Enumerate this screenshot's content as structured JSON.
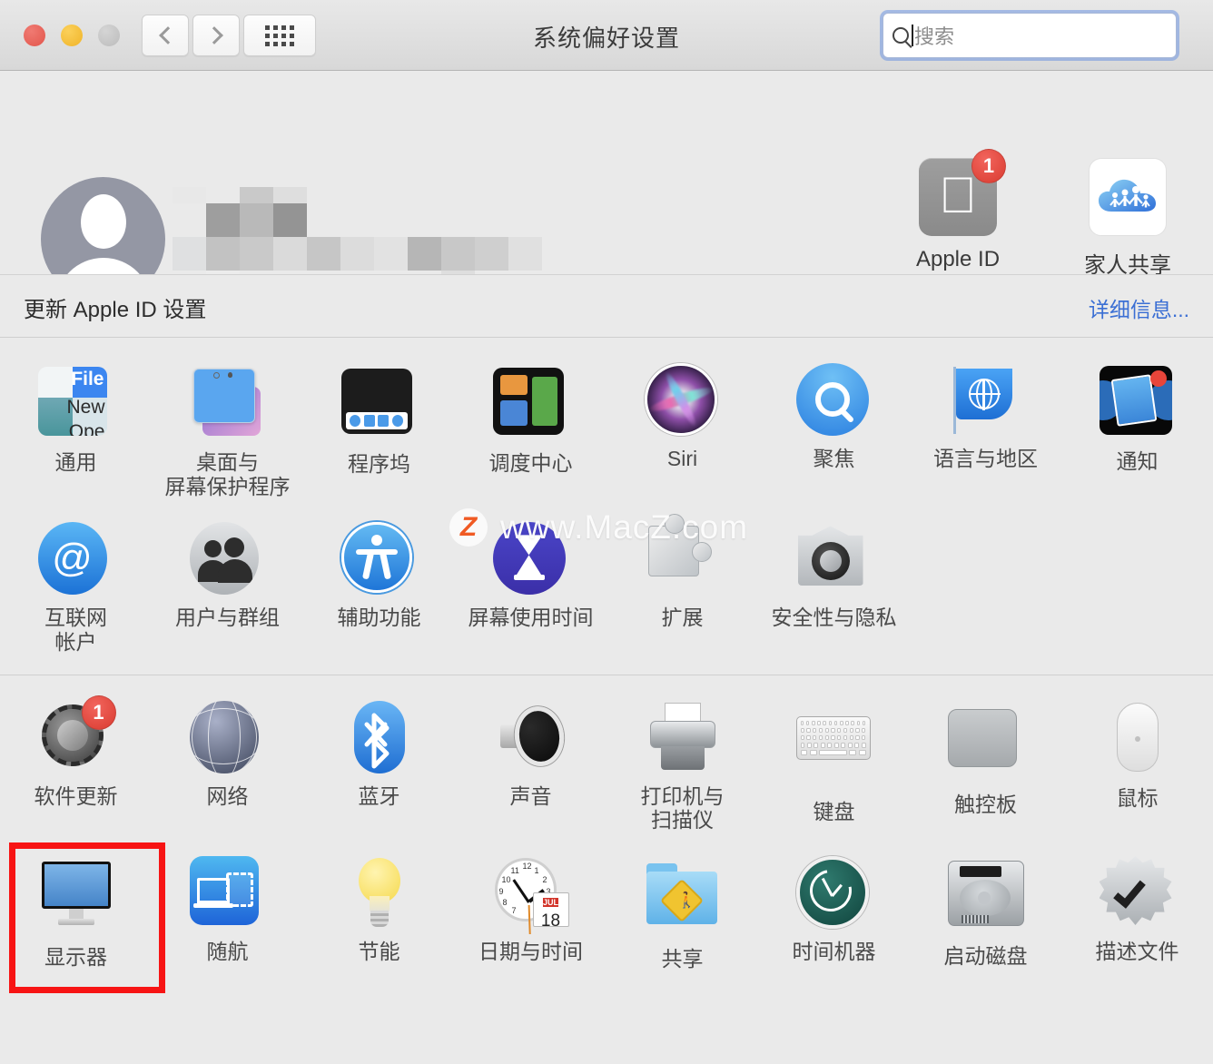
{
  "window": {
    "title": "系统偏好设置",
    "traffic_lights": [
      "close",
      "minimize",
      "zoom"
    ],
    "nav": {
      "back": "back-chevron",
      "forward": "forward-chevron",
      "show_all": "grid-dots"
    }
  },
  "search": {
    "placeholder": "搜索",
    "value": "",
    "icon": "search-icon",
    "focused": true
  },
  "account": {
    "avatar": "default-user-avatar",
    "name_redacted": true,
    "update_row": {
      "label": "更新 Apple ID 设置",
      "link": "详细信息..."
    },
    "tiles": [
      {
        "id": "apple-id",
        "label": "Apple ID",
        "badge": "1"
      },
      {
        "id": "family-sharing",
        "label": "家人共享",
        "badge": ""
      }
    ]
  },
  "sections": [
    {
      "id": "personal",
      "panes": [
        {
          "id": "general",
          "label": "通用",
          "label_lines": [
            "通用"
          ]
        },
        {
          "id": "desktop",
          "label": "桌面与屏幕保护程序",
          "label_lines": [
            "桌面与",
            "屏幕保护程序"
          ]
        },
        {
          "id": "dock",
          "label": "程序坞",
          "label_lines": [
            "程序坞"
          ]
        },
        {
          "id": "mission-control",
          "label": "调度中心",
          "label_lines": [
            "调度中心"
          ]
        },
        {
          "id": "siri",
          "label": "Siri",
          "label_lines": [
            "Siri"
          ]
        },
        {
          "id": "spotlight",
          "label": "聚焦",
          "label_lines": [
            "聚焦"
          ]
        },
        {
          "id": "language",
          "label": "语言与地区",
          "label_lines": [
            "语言与地区"
          ]
        },
        {
          "id": "notifications",
          "label": "通知",
          "label_lines": [
            "通知"
          ]
        },
        {
          "id": "internet-accounts",
          "label": "互联网帐户",
          "label_lines": [
            "互联网",
            "帐户"
          ]
        },
        {
          "id": "users-groups",
          "label": "用户与群组",
          "label_lines": [
            "用户与群组"
          ]
        },
        {
          "id": "accessibility",
          "label": "辅助功能",
          "label_lines": [
            "辅助功能"
          ]
        },
        {
          "id": "screen-time",
          "label": "屏幕使用时间",
          "label_lines": [
            "屏幕使用时间"
          ]
        },
        {
          "id": "extensions",
          "label": "扩展",
          "label_lines": [
            "扩展"
          ]
        },
        {
          "id": "security",
          "label": "安全性与隐私",
          "label_lines": [
            "安全性与隐私"
          ]
        }
      ]
    },
    {
      "id": "hardware",
      "panes": [
        {
          "id": "software-update",
          "label": "软件更新",
          "label_lines": [
            "软件更新"
          ],
          "badge": "1"
        },
        {
          "id": "network",
          "label": "网络",
          "label_lines": [
            "网络"
          ]
        },
        {
          "id": "bluetooth",
          "label": "蓝牙",
          "label_lines": [
            "蓝牙"
          ]
        },
        {
          "id": "sound",
          "label": "声音",
          "label_lines": [
            "声音"
          ]
        },
        {
          "id": "printers",
          "label": "打印机与扫描仪",
          "label_lines": [
            "打印机与",
            "扫描仪"
          ]
        },
        {
          "id": "keyboard",
          "label": "键盘",
          "label_lines": [
            "键盘"
          ]
        },
        {
          "id": "trackpad",
          "label": "触控板",
          "label_lines": [
            "触控板"
          ]
        },
        {
          "id": "mouse",
          "label": "鼠标",
          "label_lines": [
            "鼠标"
          ]
        },
        {
          "id": "displays",
          "label": "显示器",
          "label_lines": [
            "显示器"
          ],
          "highlighted": true
        },
        {
          "id": "sidecar",
          "label": "随航",
          "label_lines": [
            "随航"
          ]
        },
        {
          "id": "energy-saver",
          "label": "节能",
          "label_lines": [
            "节能"
          ]
        },
        {
          "id": "date-time",
          "label": "日期与时间",
          "label_lines": [
            "日期与时间"
          ]
        },
        {
          "id": "sharing",
          "label": "共享",
          "label_lines": [
            "共享"
          ]
        },
        {
          "id": "time-machine",
          "label": "时间机器",
          "label_lines": [
            "时间机器"
          ]
        },
        {
          "id": "startup-disk",
          "label": "启动磁盘",
          "label_lines": [
            "启动磁盘"
          ]
        },
        {
          "id": "profiles",
          "label": "描述文件",
          "label_lines": [
            "描述文件"
          ]
        }
      ]
    }
  ],
  "date_time_icon": {
    "month": "JUL",
    "day": "18"
  },
  "watermark": {
    "logo": "Z",
    "text": "www.MacZ.com"
  },
  "colors": {
    "accent_link": "#3b6fd4",
    "badge_red": "#d93b30",
    "highlight_red": "#f71414",
    "window_bg": "#eaeaea"
  }
}
